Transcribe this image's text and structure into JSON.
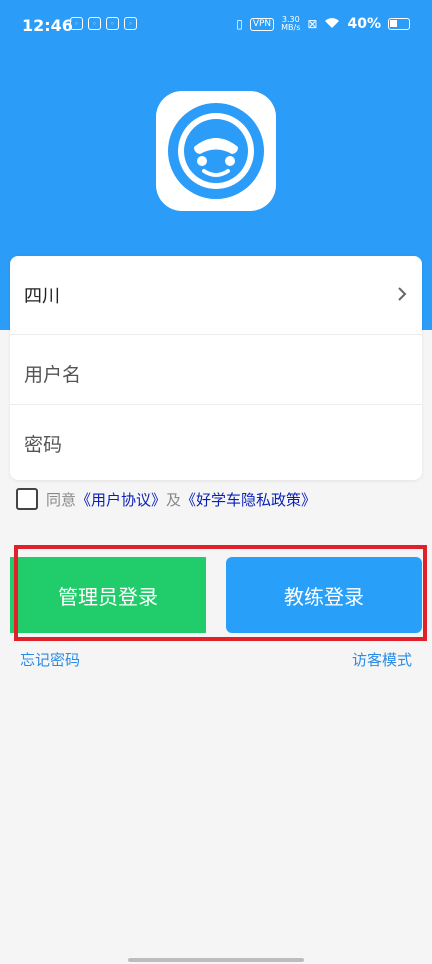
{
  "status_bar": {
    "time": "12:46",
    "vpn": "VPN",
    "speed_value": "3.30",
    "speed_unit": "MB/s",
    "battery": "40%"
  },
  "form": {
    "province": "四川",
    "username_placeholder": "用户名",
    "password_placeholder": "密码"
  },
  "agreement": {
    "prefix": "同意",
    "user_agreement": "《用户协议》",
    "connector": "及",
    "privacy_policy": "《好学车隐私政策》"
  },
  "buttons": {
    "admin_login": "管理员登录",
    "coach_login": "教练登录"
  },
  "links": {
    "forgot_password": "忘记密码",
    "guest_mode": "访客模式"
  },
  "colors": {
    "brand_blue": "#2b9cf8",
    "admin_green": "#21cd6a",
    "coach_blue": "#28a0f9",
    "highlight_red": "#e0202a"
  }
}
